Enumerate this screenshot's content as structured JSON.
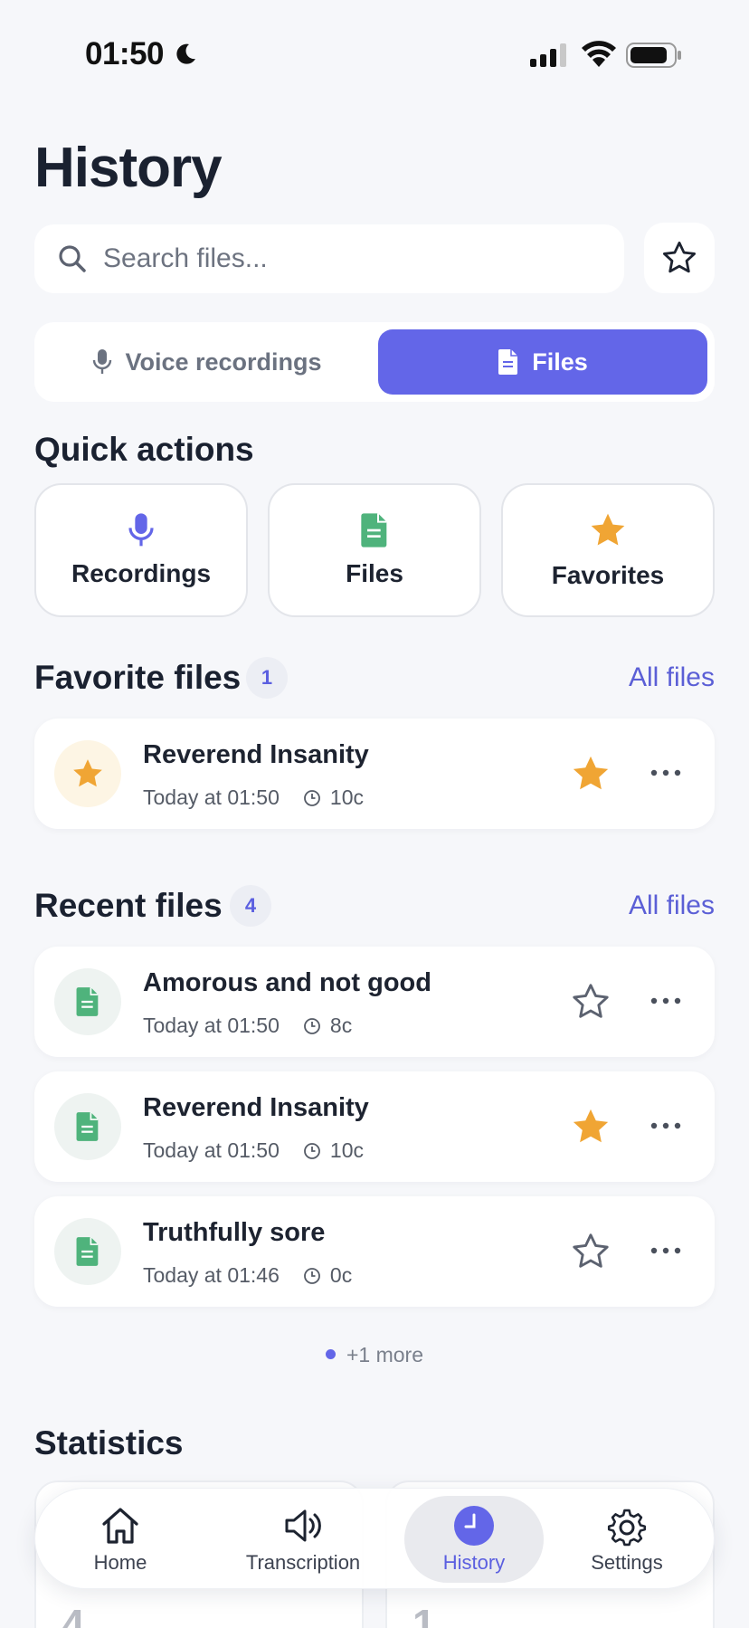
{
  "status_bar": {
    "time": "01:50"
  },
  "page": {
    "title": "History"
  },
  "search": {
    "placeholder": "Search files...",
    "value": ""
  },
  "tabs": [
    {
      "label": "Voice recordings",
      "icon": "microphone-icon",
      "selected": false
    },
    {
      "label": "Files",
      "icon": "document-icon",
      "selected": true
    }
  ],
  "quick_actions": {
    "title": "Quick actions",
    "items": [
      {
        "label": "Recordings",
        "icon": "microphone-icon",
        "color": "#6366e8"
      },
      {
        "label": "Files",
        "icon": "document-icon",
        "color": "#4fb37c"
      },
      {
        "label": "Favorites",
        "icon": "star-icon",
        "color": "#f0a534"
      }
    ]
  },
  "favorite_files": {
    "title": "Favorite files",
    "count": "1",
    "see_all": "All files",
    "items": [
      {
        "name": "Reverend Insanity",
        "date": "Today at 01:50",
        "duration": "10c",
        "favorite": true
      }
    ]
  },
  "recent_files": {
    "title": "Recent files",
    "count": "4",
    "see_all": "All files",
    "items": [
      {
        "name": "Amorous and not good",
        "date": "Today at 01:50",
        "duration": "8c",
        "favorite": false
      },
      {
        "name": "Reverend Insanity",
        "date": "Today at 01:50",
        "duration": "10c",
        "favorite": true
      },
      {
        "name": "Truthfully sore",
        "date": "Today at 01:46",
        "duration": "0c",
        "favorite": false
      }
    ],
    "more_label": "+1 more"
  },
  "statistics": {
    "title": "Statistics",
    "values": [
      "4",
      "1"
    ]
  },
  "bottom_nav": [
    {
      "label": "Home",
      "icon": "home-icon",
      "active": false
    },
    {
      "label": "Transcription",
      "icon": "speaker-icon",
      "active": false
    },
    {
      "label": "History",
      "icon": "clock-icon",
      "active": true
    },
    {
      "label": "Settings",
      "icon": "gear-icon",
      "active": false
    }
  ],
  "colors": {
    "accent": "#6366e8",
    "favorite": "#f0a534",
    "document": "#4fb37c"
  }
}
